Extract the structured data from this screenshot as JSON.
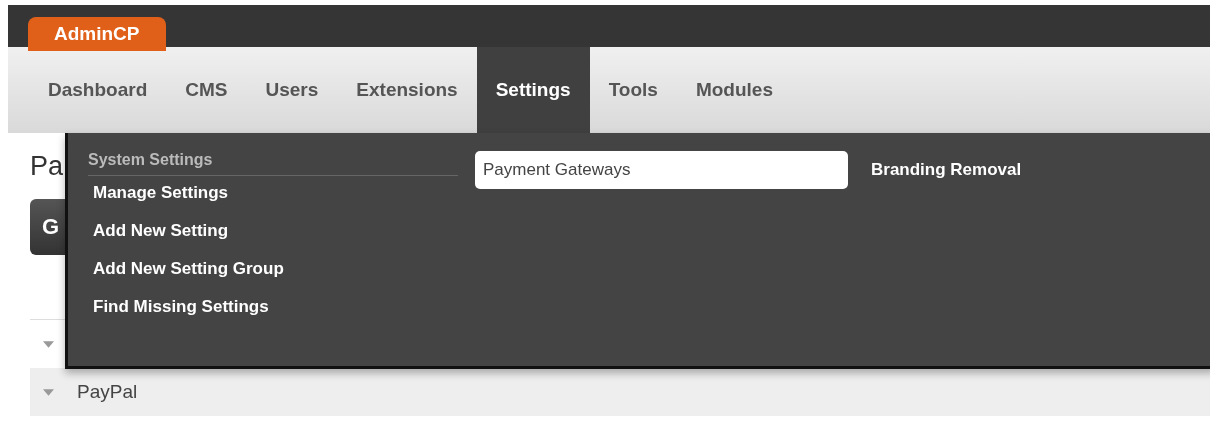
{
  "brand": "AdminCP",
  "nav": [
    {
      "label": "Dashboard",
      "selected": false
    },
    {
      "label": "CMS",
      "selected": false
    },
    {
      "label": "Users",
      "selected": false
    },
    {
      "label": "Extensions",
      "selected": false
    },
    {
      "label": "Settings",
      "selected": true
    },
    {
      "label": "Tools",
      "selected": false
    },
    {
      "label": "Modules",
      "selected": false
    }
  ],
  "page": {
    "title": "Pa",
    "tab_bar": "G",
    "rows": [
      {
        "label": "",
        "expanded": false
      },
      {
        "label": "PayPal",
        "expanded": false
      }
    ]
  },
  "dropdown": {
    "sections": [
      {
        "title": "System Settings",
        "items": [
          {
            "label": "Manage Settings",
            "selected": false
          },
          {
            "label": "Add New Setting",
            "selected": false
          },
          {
            "label": "Add New Setting Group",
            "selected": false
          },
          {
            "label": "Find Missing Settings",
            "selected": false
          }
        ]
      },
      {
        "items": [
          {
            "label": "Payment Gateways",
            "selected": true
          }
        ]
      },
      {
        "items": [
          {
            "label": "Branding Removal",
            "selected": false
          }
        ]
      }
    ]
  }
}
